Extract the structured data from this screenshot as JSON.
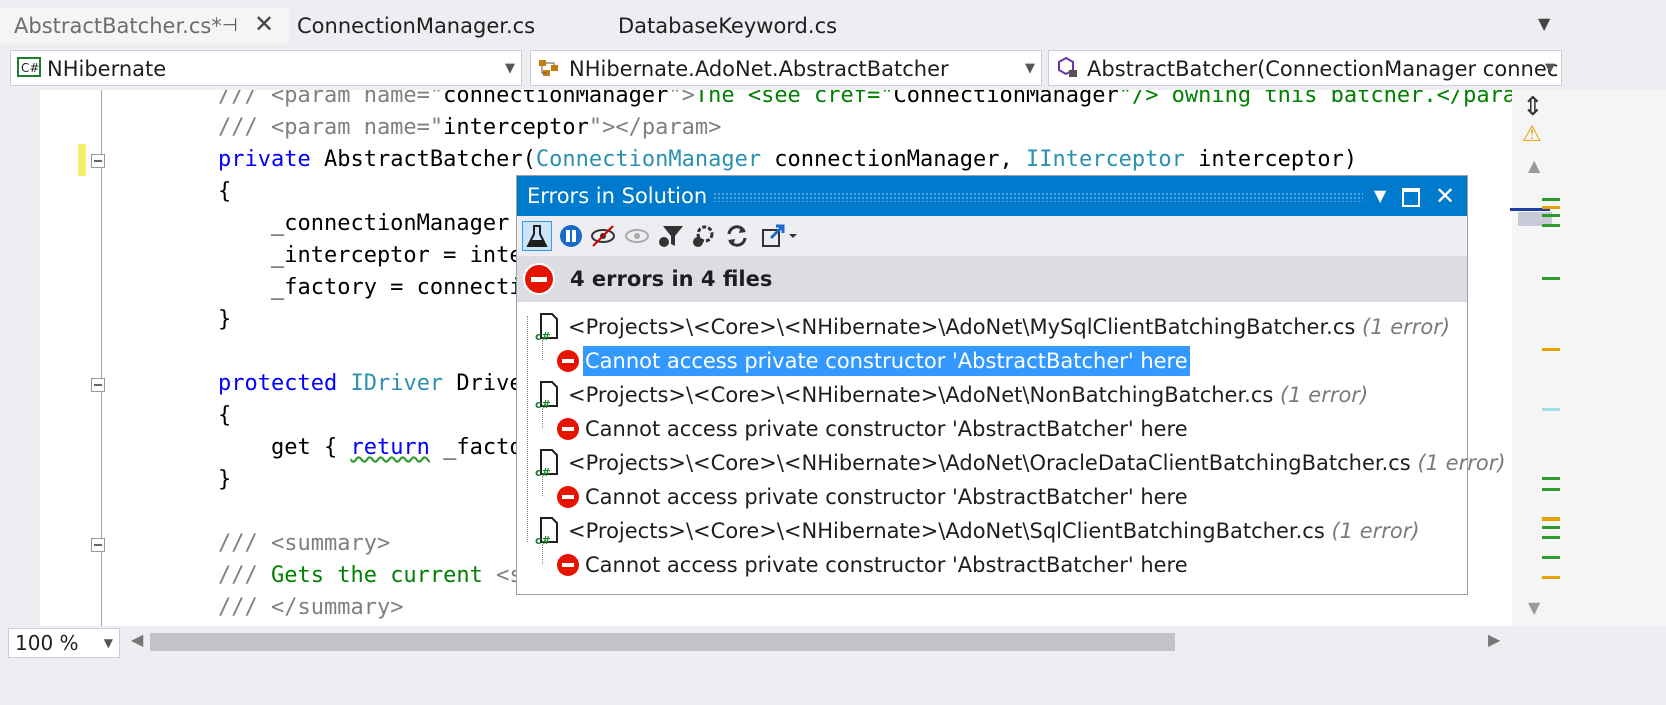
{
  "tabs": [
    {
      "label": "AbstractBatcher.cs*",
      "active": true
    },
    {
      "label": "ConnectionManager.cs",
      "active": false
    },
    {
      "label": "DatabaseKeyword.cs",
      "active": false
    }
  ],
  "nav": {
    "project": "NHibernate",
    "type": "NHibernate.AdoNet.AbstractBatcher",
    "member": "AbstractBatcher(ConnectionManager connec"
  },
  "code": {
    "l1_prefix": "/// <param name=\"",
    "l1_name": "connectionManager",
    "l1_mid": "\">",
    "l1_text": "The <see cref=\"",
    "l1_cref": "ConnectionManager",
    "l1_end": "\"/> owning this batcher.</param>",
    "l2_prefix": "/// <param name=\"",
    "l2_name": "interceptor",
    "l2_end": "\"></param>",
    "l3_kw": "private",
    "l3_name": " AbstractBatcher(",
    "l3_t1": "ConnectionManager",
    "l3_p1": " connectionManager, ",
    "l3_t2": "IInterceptor",
    "l3_p2": " interceptor)",
    "l4": "{",
    "l5": "    _connectionManager",
    "l6": "    _interceptor = inte",
    "l7": "    _factory = connecti",
    "l8": "}",
    "l10_kw": "protected",
    "l10_type": " IDriver",
    "l10_rest": " Drive",
    "l11": "{",
    "l12_a": "    get { ",
    "l12_kw": "return",
    "l12_b": " _facto",
    "l13": "}",
    "l15_prefix": "/// ",
    "l15_tag": "<summary>",
    "l16_prefix": "/// ",
    "l16_text": "Gets the current ",
    "l16_tag": "<s",
    "l17_prefix": "/// ",
    "l17_tag": "</summary>"
  },
  "popup": {
    "title": "Errors in Solution",
    "summary": "4 errors in 4 files",
    "files": [
      {
        "path": "<Projects>\\<Core>\\<NHibernate>\\AdoNet\\MySqlClientBatchingBatcher.cs",
        "count": "(1 error)",
        "message": "Cannot access private constructor 'AbstractBatcher' here",
        "selected": true
      },
      {
        "path": "<Projects>\\<Core>\\<NHibernate>\\AdoNet\\NonBatchingBatcher.cs",
        "count": "(1 error)",
        "message": "Cannot access private constructor 'AbstractBatcher' here",
        "selected": false
      },
      {
        "path": "<Projects>\\<Core>\\<NHibernate>\\AdoNet\\OracleDataClientBatchingBatcher.cs",
        "count": "(1 error)",
        "message": "Cannot access private constructor 'AbstractBatcher' here",
        "selected": false
      },
      {
        "path": "<Projects>\\<Core>\\<NHibernate>\\AdoNet\\SqlClientBatchingBatcher.cs",
        "count": "(1 error)",
        "message": "Cannot access private constructor 'AbstractBatcher' here",
        "selected": false
      }
    ]
  },
  "zoom": "100 %",
  "colors": {
    "accent": "#007acc",
    "error": "#e51400",
    "selection": "#3399ff"
  }
}
